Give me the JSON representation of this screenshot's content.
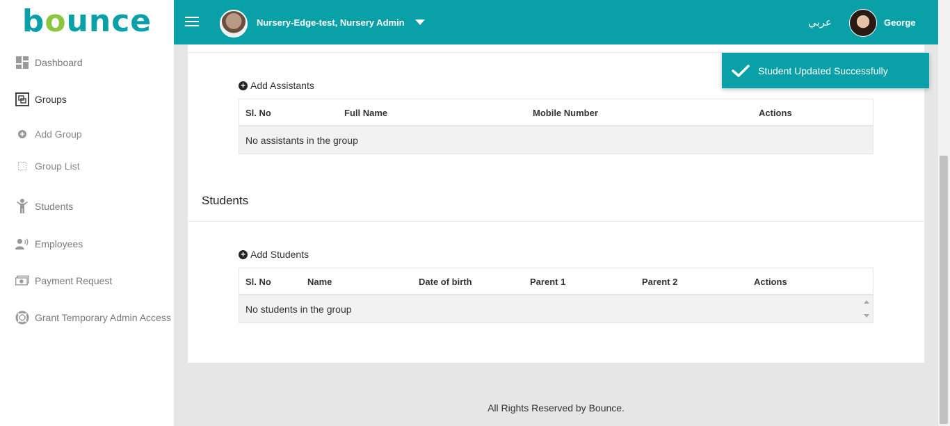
{
  "brand": {
    "logo_text_a": "b",
    "logo_text_b": "unce"
  },
  "sidebar": {
    "items": [
      {
        "label": "Dashboard",
        "icon": "dashboard-icon"
      },
      {
        "label": "Groups",
        "icon": "groups-icon"
      },
      {
        "label": "Add Group",
        "icon": "plus-circle-icon"
      },
      {
        "label": "Group List",
        "icon": "dotted-square-icon"
      },
      {
        "label": "Students",
        "icon": "child-icon"
      },
      {
        "label": "Employees",
        "icon": "employee-icon"
      },
      {
        "label": "Payment Request",
        "icon": "money-icon"
      },
      {
        "label": "Grant Temporary Admin Access",
        "icon": "lifebuoy-icon"
      }
    ]
  },
  "header": {
    "nursery_name": "Nursery-Edge-test, Nursery Admin",
    "language": "عربي",
    "user_name": "George"
  },
  "assistants": {
    "add_label": "Add Assistants",
    "columns": [
      "Sl. No",
      "Full Name",
      "Mobile Number",
      "Actions"
    ],
    "empty_text": "No assistants in the group"
  },
  "students": {
    "section_title": "Students",
    "add_label": "Add Students",
    "columns": [
      "Sl. No",
      "Name",
      "Date of birth",
      "Parent 1",
      "Parent 2",
      "Actions"
    ],
    "empty_text": "No students in the group"
  },
  "footer": {
    "text": "All Rights Reserved by Bounce."
  },
  "toast": {
    "message": "Student Updated Successfully"
  },
  "colors": {
    "primary": "#0aa0a8",
    "logo_accent": "#8cc63f"
  }
}
